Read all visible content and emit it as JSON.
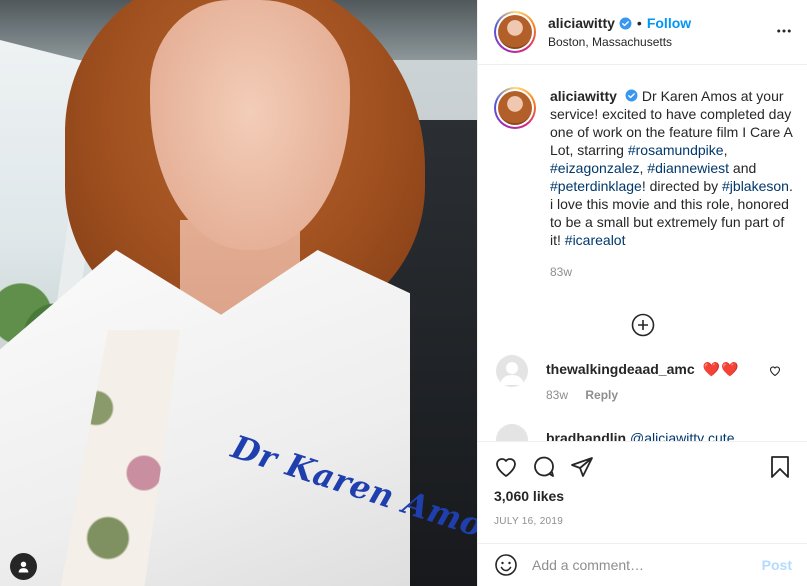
{
  "photo": {
    "embroidery_text": "Dr Karen Amos",
    "tag_icon": "user-tag-icon"
  },
  "header": {
    "username": "aliciawitty",
    "verified_icon": "verified-badge-icon",
    "separator": "•",
    "follow_label": "Follow",
    "location": "Boston, Massachusetts",
    "more_icon": "more-options-icon"
  },
  "caption": {
    "username": "aliciawitty",
    "text_before": "Dr Karen Amos at your service! excited to have completed day one of work on the feature film I Care A Lot, starring ",
    "tag1": "#rosamundpike",
    "sep1": ", ",
    "tag2": "#eizagonzalez",
    "sep2": ", ",
    "tag3": "#diannewiest",
    "sep3": " and ",
    "tag4": "#peterdinklage",
    "sep4": "! directed by ",
    "tag5": "#jblakeson",
    "text_after": ". i love this movie and this role, honored to be a small but extremely fun part of it! ",
    "tag6": "#icarealot",
    "age": "83w"
  },
  "load_more_icon": "plus-circle-icon",
  "comments": [
    {
      "username": "thewalkingdeaad_amc",
      "text": "❤️❤️",
      "age": "83w",
      "reply_label": "Reply"
    },
    {
      "username": "bradhandlin",
      "text": "@aliciawitty cute"
    }
  ],
  "actions": {
    "like_icon": "heart-icon",
    "comment_icon": "comment-icon",
    "share_icon": "share-icon",
    "save_icon": "bookmark-icon",
    "likes": "3,060 likes",
    "date": "JULY 16, 2019"
  },
  "add_comment": {
    "emoji_icon": "emoji-icon",
    "placeholder": "Add a comment…",
    "post_label": "Post"
  },
  "colors": {
    "link": "#00376b",
    "follow": "#0095f6",
    "muted": "#8e8e8e",
    "post_disabled": "#b3dbff"
  }
}
